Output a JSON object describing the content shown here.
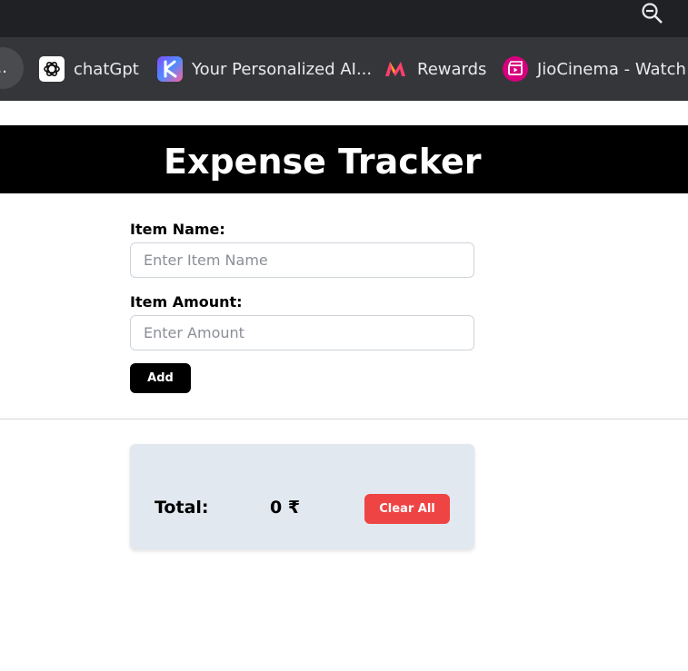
{
  "browser": {
    "bookmarks": {
      "partial_label": "...",
      "items": [
        {
          "label": "chatGpt",
          "icon": "openai-icon"
        },
        {
          "label": "Your Personalized AI...",
          "icon": "ai-assistant-icon"
        },
        {
          "label": "Rewards",
          "icon": "myntra-icon"
        },
        {
          "label": "JioCinema - Watch S",
          "icon": "jiocinema-icon"
        }
      ]
    },
    "toolbar_icon": "zoom-out-icon"
  },
  "app": {
    "title": "Expense Tracker",
    "form": {
      "item_name_label": "Item Name:",
      "item_name_placeholder": "Enter Item Name",
      "item_name_value": "",
      "amount_label": "Item Amount:",
      "amount_placeholder": "Enter Amount",
      "amount_value": "",
      "add_label": "Add"
    },
    "summary": {
      "total_label": "Total:",
      "total_value": "0 ₹",
      "clear_label": "Clear All"
    }
  },
  "colors": {
    "header_bg": "#000000",
    "card_bg": "#e2e8f0",
    "clear_button": "#ef4444",
    "add_button": "#000000"
  }
}
